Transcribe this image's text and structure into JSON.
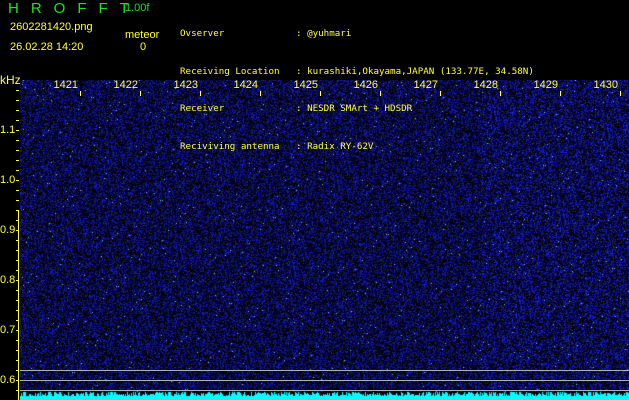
{
  "app": {
    "logo": "HROFFT",
    "version": "1.00f",
    "filename": "2602281420.png",
    "datetime": "26.02.28 14:20",
    "meteor_label": "meteor",
    "meteor_count": "0"
  },
  "info": [
    {
      "key": "Ovserver",
      "value": ": @yuhmari"
    },
    {
      "key": "Receiving Location",
      "value": ": kurashiki,Okayama,JAPAN (133.77E, 34.58N)"
    },
    {
      "key": "Receiver",
      "value": ": NESDR SMArt + HDSDR"
    },
    {
      "key": "Reciviving antenna",
      "value": ": Radix RY-62V"
    }
  ],
  "axis": {
    "y_unit": "kHz",
    "x_ticks": [
      "1421",
      "1422",
      "1423",
      "1424",
      "1425",
      "1426",
      "1427",
      "1428",
      "1429",
      "1430"
    ],
    "y_ticks": [
      "1.1",
      "1.0",
      "0.9",
      "0.8",
      "0.7",
      "0.6"
    ]
  },
  "colors": {
    "noise": "#2030ff",
    "signal": "#00ffff",
    "text": "#ffff40",
    "logo": "#20e020"
  }
}
